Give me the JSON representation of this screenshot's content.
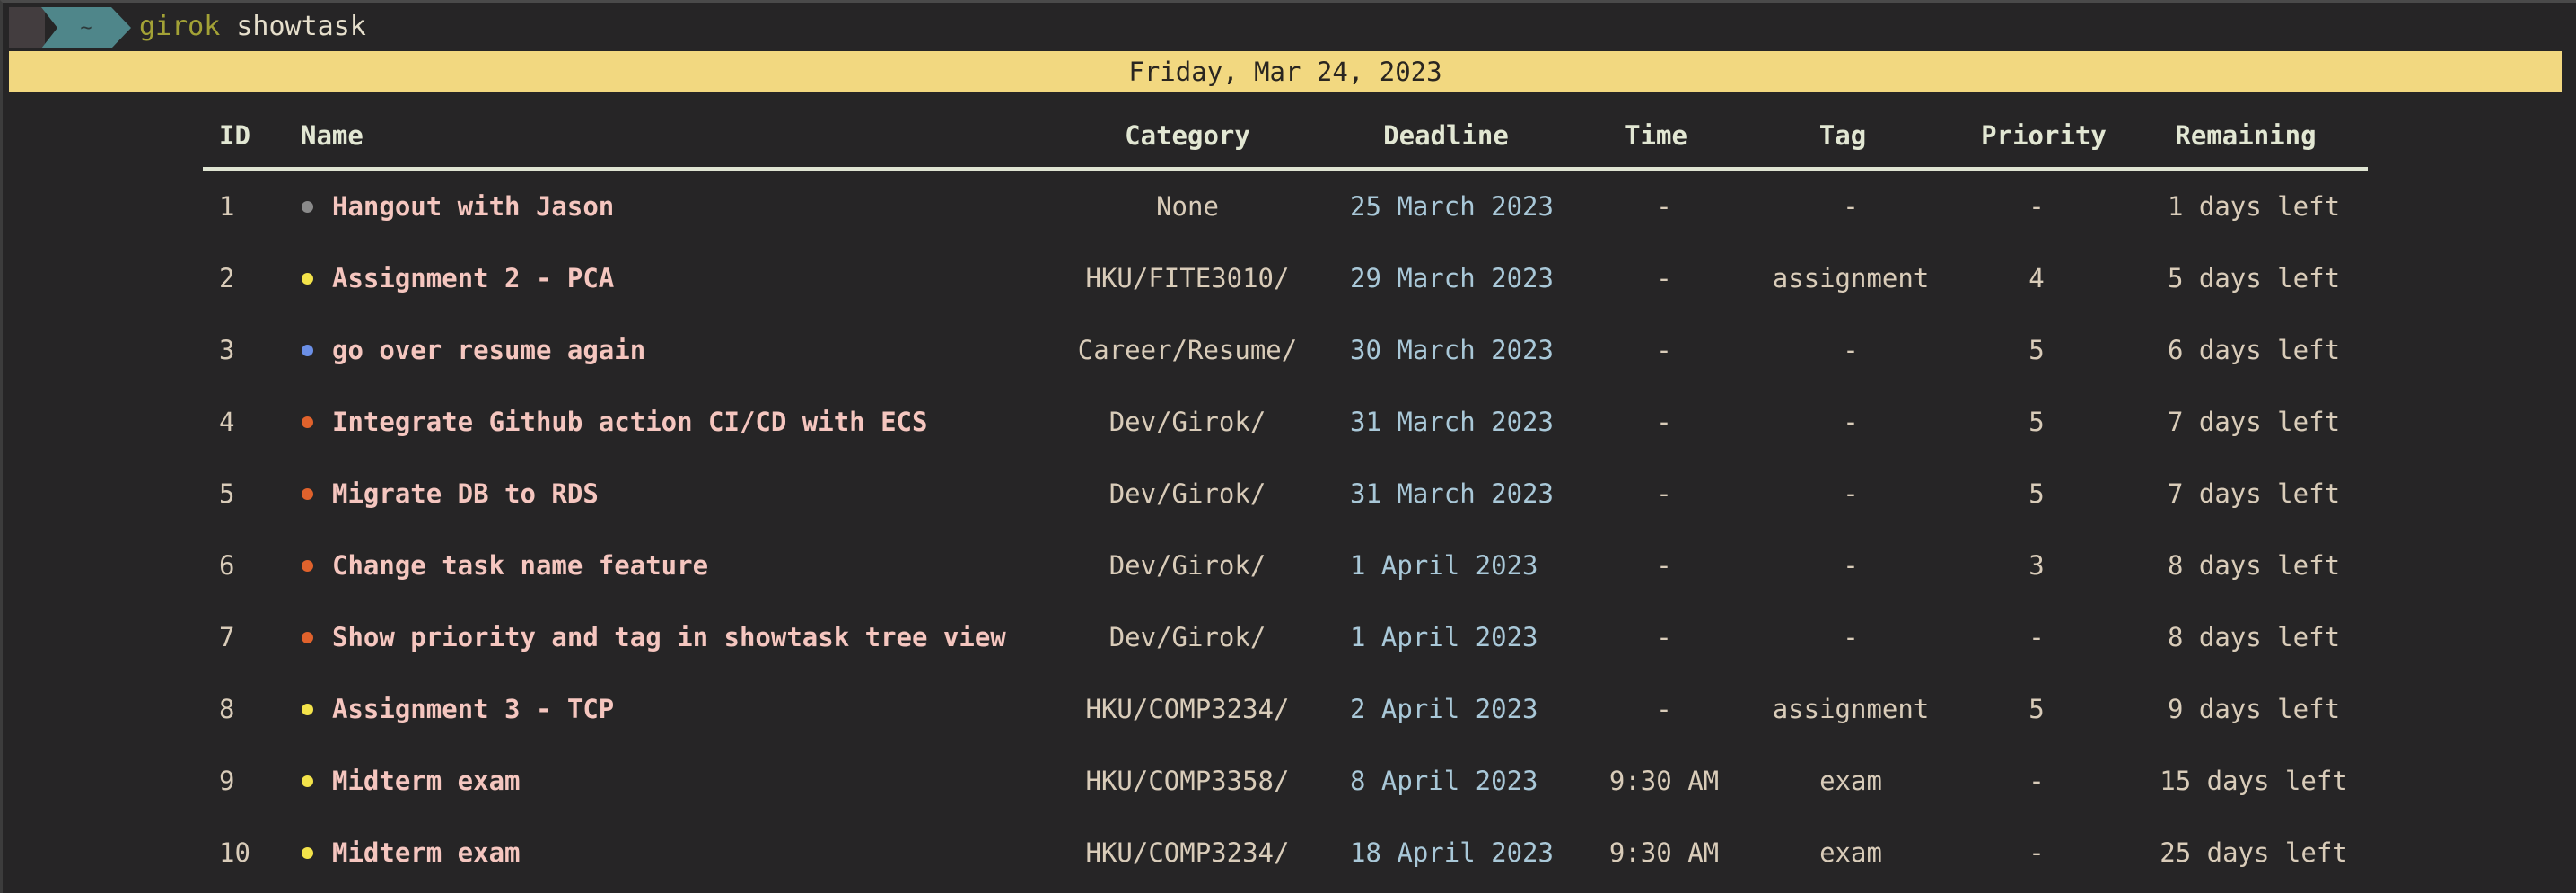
{
  "terminal": {
    "prompt_symbol": "~",
    "command": "girok",
    "argument": "showtask"
  },
  "date_banner": "Friday, Mar 24, 2023",
  "columns": {
    "id": "ID",
    "name": "Name",
    "category": "Category",
    "deadline": "Deadline",
    "time": "Time",
    "tag": "Tag",
    "priority": "Priority",
    "remaining": "Remaining"
  },
  "colors": {
    "grey": "#8a8a8a",
    "yellow": "#f3e34a",
    "blue": "#6b8fe6",
    "orange": "#e0622c"
  },
  "tasks": [
    {
      "id": "1",
      "dot": "grey",
      "name": "Hangout with Jason",
      "category": "None",
      "deadline": "25 March 2023",
      "time": "-",
      "tag": "-",
      "priority": "-",
      "remaining": "1 days left"
    },
    {
      "id": "2",
      "dot": "yellow",
      "name": "Assignment 2 - PCA",
      "category": "HKU/FITE3010/",
      "deadline": "29 March 2023",
      "time": "-",
      "tag": "assignment",
      "priority": "4",
      "remaining": "5 days left"
    },
    {
      "id": "3",
      "dot": "blue",
      "name": "go over resume again",
      "category": "Career/Resume/",
      "deadline": "30 March 2023",
      "time": "-",
      "tag": "-",
      "priority": "5",
      "remaining": "6 days left"
    },
    {
      "id": "4",
      "dot": "orange",
      "name": "Integrate Github action CI/CD with ECS",
      "category": "Dev/Girok/",
      "deadline": "31 March 2023",
      "time": "-",
      "tag": "-",
      "priority": "5",
      "remaining": "7 days left"
    },
    {
      "id": "5",
      "dot": "orange",
      "name": "Migrate DB to RDS",
      "category": "Dev/Girok/",
      "deadline": "31 March 2023",
      "time": "-",
      "tag": "-",
      "priority": "5",
      "remaining": "7 days left"
    },
    {
      "id": "6",
      "dot": "orange",
      "name": "Change task name feature",
      "category": "Dev/Girok/",
      "deadline": "1 April 2023",
      "time": "-",
      "tag": "-",
      "priority": "3",
      "remaining": "8 days left"
    },
    {
      "id": "7",
      "dot": "orange",
      "name": "Show priority and tag in showtask tree view",
      "category": "Dev/Girok/",
      "deadline": "1 April 2023",
      "time": "-",
      "tag": "-",
      "priority": "-",
      "remaining": "8 days left"
    },
    {
      "id": "8",
      "dot": "yellow",
      "name": "Assignment 3 - TCP",
      "category": "HKU/COMP3234/",
      "deadline": "2 April 2023",
      "time": "-",
      "tag": "assignment",
      "priority": "5",
      "remaining": "9 days left"
    },
    {
      "id": "9",
      "dot": "yellow",
      "name": "Midterm exam",
      "category": "HKU/COMP3358/",
      "deadline": "8 April 2023",
      "time": "9:30 AM",
      "tag": "exam",
      "priority": "-",
      "remaining": "15 days left"
    },
    {
      "id": "10",
      "dot": "yellow",
      "name": "Midterm exam",
      "category": "HKU/COMP3234/",
      "deadline": "18 April 2023",
      "time": "9:30 AM",
      "tag": "exam",
      "priority": "-",
      "remaining": "25 days left"
    }
  ]
}
